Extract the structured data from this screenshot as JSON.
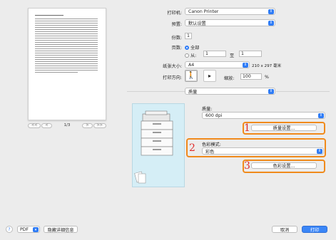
{
  "preview": {
    "page_count": "1/3",
    "nav_first": "<<",
    "nav_prev": "<",
    "nav_next": ">",
    "nav_last": ">>"
  },
  "form": {
    "printer_label": "打印机:",
    "printer_value": "Canon Printer",
    "preset_label": "预置:",
    "preset_value": "默认设置",
    "copies_label": "份数:",
    "copies_value": "1",
    "pages_label": "页数:",
    "pages_all": "全部",
    "pages_from": "从:",
    "pages_from_value": "1",
    "pages_to": "至",
    "pages_to_value": "1",
    "paper_label": "纸张大小:",
    "paper_value": "A4",
    "paper_dims": "210 x 297 毫米",
    "orientation_label": "打印方向:",
    "scale_label": "缩放:",
    "scale_value": "100",
    "scale_unit": "%",
    "section_value": "质量"
  },
  "quality": {
    "quality_label": "质量:",
    "quality_value": "600 dpi",
    "quality_settings_button": "质量设置...",
    "color_mode_label": "色彩模式:",
    "color_mode_value": "彩色",
    "color_settings_button": "色彩设置..."
  },
  "callouts": [
    "1",
    "2",
    "3"
  ],
  "bottom": {
    "help": "?",
    "pdf": "PDF",
    "hide_details": "隐藏详细信息",
    "cancel": "取消",
    "print": "打印"
  },
  "colors": {
    "accent": "#2f7cf6",
    "callout_border": "#f08a1c",
    "callout_number": "#e02b2b",
    "preview_bg": "#d5eef6"
  }
}
